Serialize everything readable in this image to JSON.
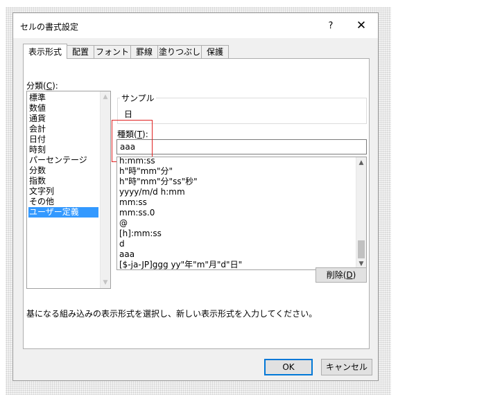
{
  "dialog": {
    "title": "セルの書式設定",
    "help_glyph": "?",
    "close_glyph": "✕"
  },
  "tabs": [
    {
      "label": "表示形式",
      "active": true
    },
    {
      "label": "配置"
    },
    {
      "label": "フォント"
    },
    {
      "label": "罫線"
    },
    {
      "label": "塗りつぶし"
    },
    {
      "label": "保護"
    }
  ],
  "category": {
    "label_prefix": "分類(",
    "label_accel": "C",
    "label_suffix": "):",
    "items": [
      "標準",
      "数値",
      "通貨",
      "会計",
      "日付",
      "時刻",
      "パーセンテージ",
      "分数",
      "指数",
      "文字列",
      "その他",
      "ユーザー定義"
    ],
    "selected_index": 11
  },
  "sample": {
    "label": "サンプル",
    "value": "日"
  },
  "type": {
    "label_prefix": "種類(",
    "label_accel": "T",
    "label_suffix": "):",
    "input_value": "aaa",
    "formats": [
      "h:mm:ss",
      "h\"時\"mm\"分\"",
      "h\"時\"mm\"分\"ss\"秒\"",
      "yyyy/m/d h:mm",
      "mm:ss",
      "mm:ss.0",
      "@",
      "[h]:mm:ss",
      "d",
      "aaa",
      "[$-ja-JP]ggg yy\"年\"m\"月\"d\"日\""
    ]
  },
  "delete_button": {
    "label_prefix": "削除(",
    "label_accel": "D",
    "label_suffix": ")"
  },
  "description": "基になる組み込みの表示形式を選択し、新しい表示形式を入力してください。",
  "footer": {
    "ok_label": "OK",
    "cancel_label": "キャンセル"
  },
  "colors": {
    "selection": "#3399ff",
    "highlight_box": "#e02020",
    "primary_border": "#0078d7"
  }
}
